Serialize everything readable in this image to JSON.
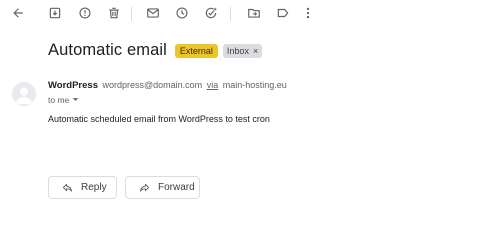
{
  "toolbar": {
    "icons": [
      "back-arrow-icon",
      "archive-icon",
      "report-spam-icon",
      "delete-icon",
      "mark-unread-icon",
      "snooze-icon",
      "add-to-tasks-icon",
      "move-to-icon",
      "label-icon",
      "more-options-icon"
    ]
  },
  "email": {
    "subject": "Automatic email",
    "labels": {
      "external": "External",
      "inbox": "Inbox"
    },
    "sender_name": "WordPress",
    "sender_email": "wordpress@domain.com",
    "via_label": "via",
    "via_host": "main-hosting.eu",
    "recipient": "to me",
    "body": "Automatic scheduled email from WordPress to test cron"
  },
  "actions": {
    "reply": "Reply",
    "forward": "Forward"
  },
  "colors": {
    "external_badge": "#ecc52b",
    "inbox_badge": "#dadce0",
    "icon": "#5f6368"
  }
}
